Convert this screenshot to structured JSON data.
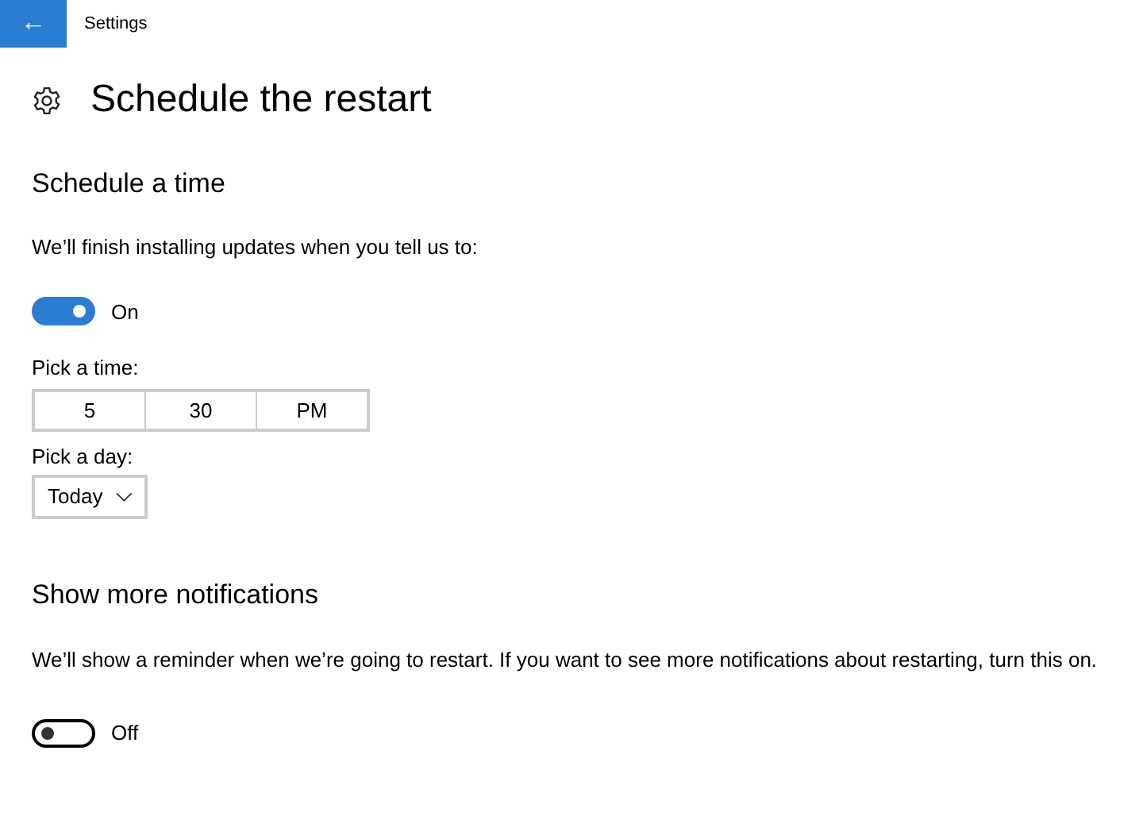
{
  "header": {
    "back_icon": "←",
    "title": "Settings"
  },
  "page_title": "Schedule the restart",
  "sections": [
    {
      "heading": "Schedule a time",
      "description": "We’ll finish installing updates when you tell us to:",
      "toggle": {
        "on": true,
        "label": "On"
      },
      "time": {
        "label": "Pick a time:",
        "parts": [
          "5",
          "30",
          "PM"
        ]
      },
      "day": {
        "label": "Pick a day:",
        "value": "Today"
      }
    },
    {
      "heading": "Show more notifications",
      "description": "We’ll show a reminder when we’re going to restart. If you want to see more notifications about restarting, turn this on.",
      "toggle": {
        "on": false,
        "label": "Off"
      }
    }
  ]
}
